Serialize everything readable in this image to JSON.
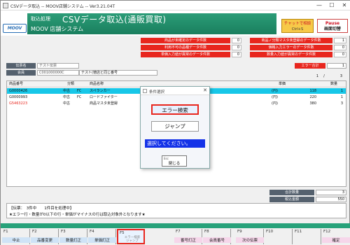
{
  "window": {
    "title": "CSVデータ取込 -- MOOV店舗システム -- Ver3.21.04T",
    "minimize": "—",
    "maximize": "☐",
    "close": "✕"
  },
  "header": {
    "logo": "MOOV",
    "process_label": "取込処理",
    "main_title": "CSVデータ取込(通販買取)",
    "system_name": "MOOV 店舗システム",
    "chat_button": "チャットで相談",
    "chat_shortcut": "Ctrl+S",
    "pause_button": "Pause",
    "pause_sub": "画面切替"
  },
  "alerts": [
    {
      "label": "商品が未確定のデータ件数",
      "value": "0"
    },
    {
      "label": "商品ノ分類マスタ未登録のデータ件数",
      "value": "1"
    },
    {
      "label": "利用不可の品種データ件数",
      "value": "0"
    },
    {
      "label": "価格入力エラーのデータ件数",
      "value": "0"
    },
    {
      "label": "単価入力値が異常のデータ件数",
      "value": "0"
    },
    {
      "label": "数量入力値が異常のデータ件数",
      "value": "0"
    }
  ],
  "slip": {
    "slip_label": "伝票名",
    "slip_value": "テスト伝票",
    "member_label": "会員",
    "member_code": "C001000000C",
    "member_name": "テスト(徳店と同じ番号"
  },
  "error_total": {
    "label": "エラー合計",
    "value": "1"
  },
  "pager": {
    "current": "1",
    "separator": "/",
    "total": "3"
  },
  "table": {
    "headers": {
      "code": "商品番号",
      "category": "分類",
      "name": "商品名称",
      "price": "単価",
      "qty": "数量"
    },
    "rows": [
      {
        "code": "G0000426",
        "cat1": "中古",
        "cat2": "FC",
        "name": "スペランカー",
        "unit": "(円)",
        "price": "118",
        "qty": "1",
        "selected": true,
        "error": false
      },
      {
        "code": "G0000993",
        "cat1": "中古",
        "cat2": "FC",
        "name": "ロードファイター",
        "unit": "(円)",
        "price": "220",
        "qty": "1",
        "selected": false,
        "error": false
      },
      {
        "code": "G5463223",
        "cat1": "中古",
        "cat2": "",
        "name": "商品マスタ未登録",
        "unit": "(円)",
        "price": "380",
        "qty": "3",
        "selected": false,
        "error": true
      }
    ]
  },
  "totals": [
    {
      "label": "合計数量",
      "value": "3"
    },
    {
      "label": "税込金額",
      "value": "550"
    }
  ],
  "info": {
    "line1": "【伝票：　3件中　　1件目を処理中】",
    "line2": "★エラー行・数量が0以下の行・単価がマイナスの行は取込対象外となります★"
  },
  "fkeys": [
    {
      "key": "F1",
      "label": "中止",
      "sub": ""
    },
    {
      "key": "F2",
      "label": "品番変更",
      "sub": ""
    },
    {
      "key": "F3",
      "label": "数量訂正",
      "sub": ""
    },
    {
      "key": "F4",
      "label": "単価訂正",
      "sub": ""
    },
    {
      "key": "F5",
      "label": "",
      "sub": "エラー検索\nジャンプ"
    },
    {
      "key": "F7",
      "label": "番号訂正",
      "sub": ""
    },
    {
      "key": "F8",
      "label": "会員番号",
      "sub": ""
    },
    {
      "key": "F9",
      "label": "次の伝票",
      "sub": ""
    },
    {
      "key": "F10",
      "label": "",
      "sub": ""
    },
    {
      "key": "F11",
      "label": "",
      "sub": ""
    },
    {
      "key": "F12",
      "label": "確定",
      "sub": ""
    }
  ],
  "dialog": {
    "title": "条件選択",
    "close": "✕",
    "error_search": "エラー検索",
    "jump": "ジャンプ",
    "message": "選択してください。",
    "close_key": "Esc",
    "close_label": "閉じる"
  },
  "colors": {
    "header_green": "#1a7f5e",
    "alert_red": "#e8261e",
    "selected_row": "#17c7e8",
    "dialog_msg": "#1432e8"
  }
}
